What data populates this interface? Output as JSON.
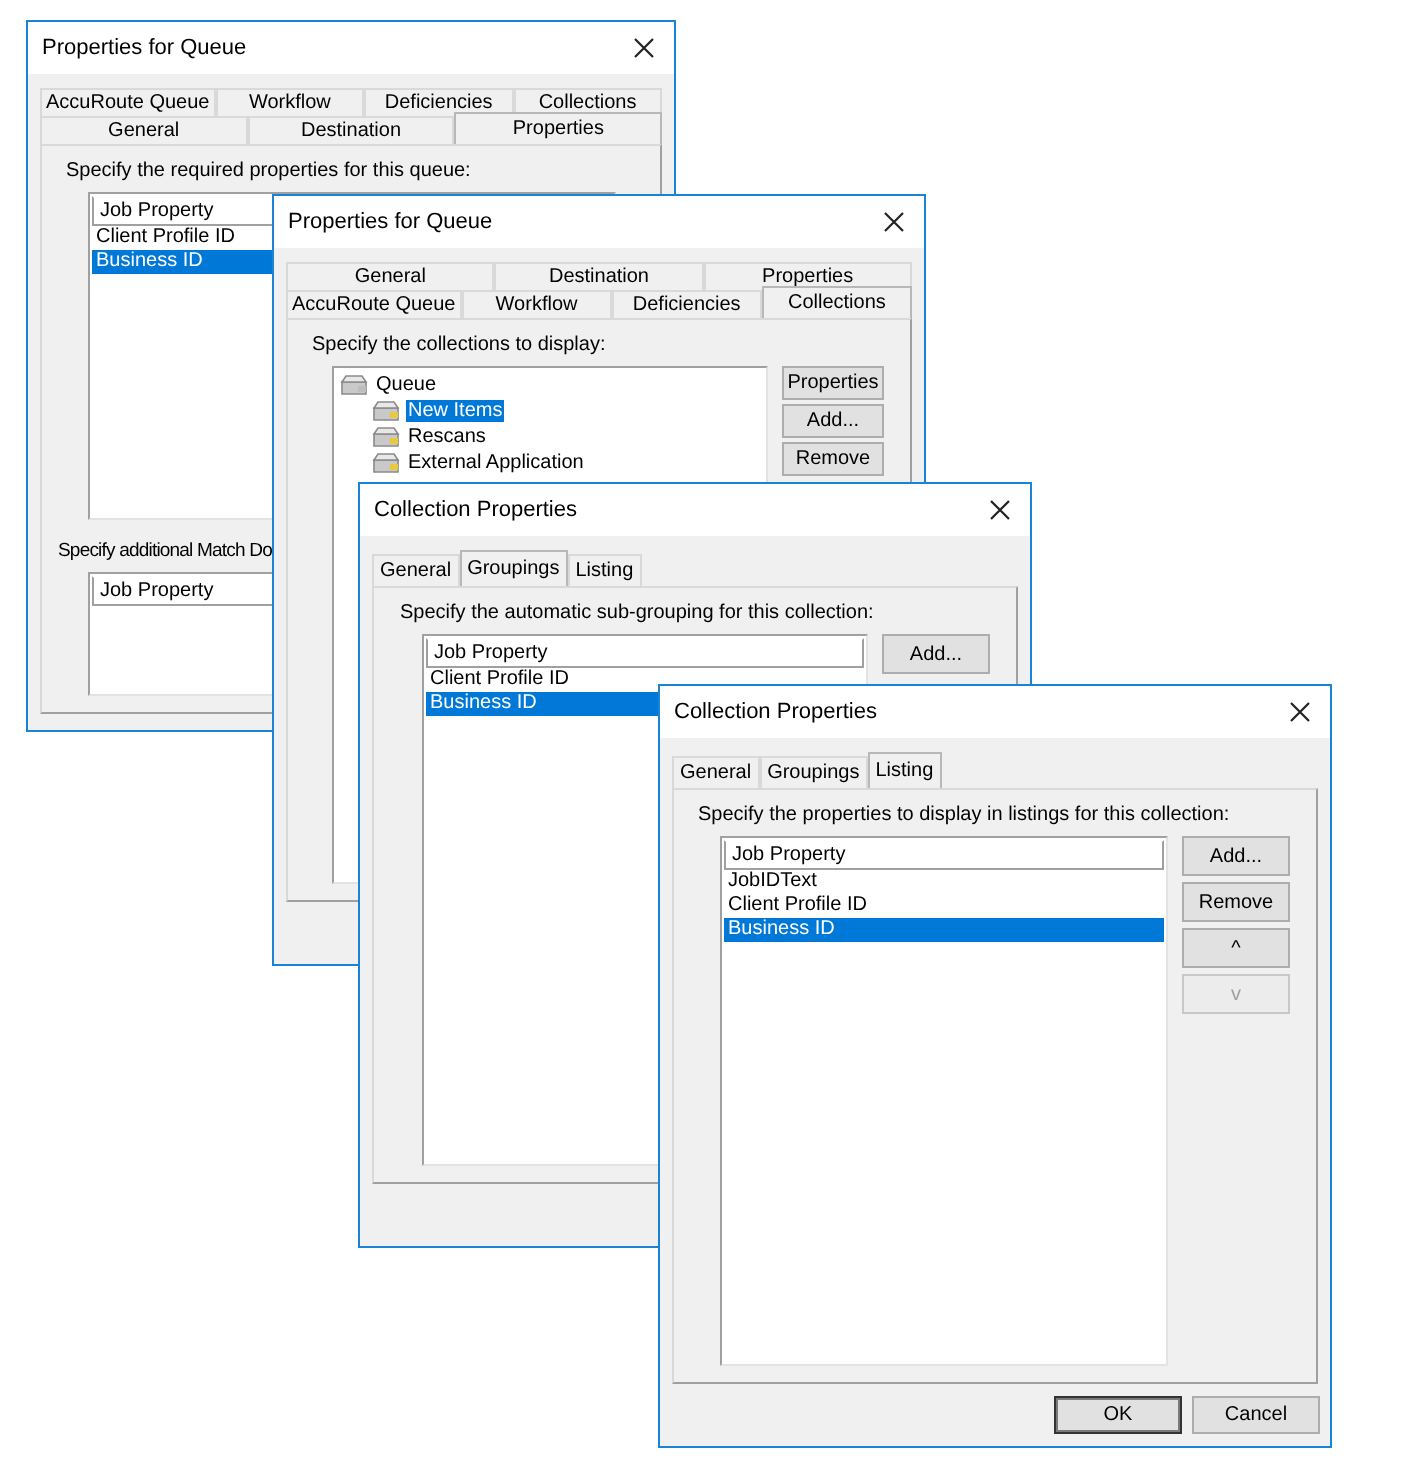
{
  "windows": [
    {
      "title": "Properties for Queue",
      "tab_rows": [
        {
          "tabs": [
            {
              "label": "AccuRoute Queue",
              "selected": false
            },
            {
              "label": "Workflow",
              "selected": false
            },
            {
              "label": "Deficiencies",
              "selected": false
            },
            {
              "label": "Collections",
              "selected": false
            }
          ]
        },
        {
          "tabs": [
            {
              "label": "General",
              "selected": false
            },
            {
              "label": "Destination",
              "selected": false
            },
            {
              "label": "Properties",
              "selected": true
            }
          ]
        }
      ],
      "sections": [
        {
          "prompt": "Specify the required properties for this queue:",
          "list": {
            "kind": "table",
            "header": "Job Property",
            "rows": [
              {
                "text": "Client Profile ID",
                "selected": false
              },
              {
                "text": "Business ID",
                "selected": true
              }
            ]
          }
        },
        {
          "prompt": "Specify additional Match Do",
          "list": {
            "kind": "table",
            "header": "Job Property"
          }
        }
      ]
    },
    {
      "title": "Properties for Queue",
      "tab_rows": [
        {
          "tabs": [
            {
              "label": "General",
              "selected": false
            },
            {
              "label": "Destination",
              "selected": false
            },
            {
              "label": "Properties",
              "selected": false
            }
          ]
        },
        {
          "tabs": [
            {
              "label": "AccuRoute Queue",
              "selected": false
            },
            {
              "label": "Workflow",
              "selected": false
            },
            {
              "label": "Deficiencies",
              "selected": false
            },
            {
              "label": "Collections",
              "selected": true
            }
          ]
        }
      ],
      "sections": [
        {
          "prompt": "Specify the collections to display:",
          "list": {
            "kind": "tree",
            "items": [
              {
                "label": "Queue",
                "selected": false,
                "children": [
                  {
                    "label": "New Items",
                    "selected": true
                  },
                  {
                    "label": "Rescans",
                    "selected": false
                  },
                  {
                    "label": "External Application",
                    "selected": false
                  }
                ]
              }
            ]
          },
          "buttons": [
            {
              "label": "Properties",
              "disabled": false
            },
            {
              "label": "Add...",
              "disabled": false
            },
            {
              "label": "Remove",
              "disabled": false
            }
          ]
        }
      ]
    },
    {
      "title": "Collection Properties",
      "tab_rows": [
        {
          "tabs": [
            {
              "label": "General",
              "selected": false
            },
            {
              "label": "Groupings",
              "selected": true
            },
            {
              "label": "Listing",
              "selected": false
            }
          ]
        }
      ],
      "sections": [
        {
          "prompt": "Specify the automatic sub-grouping for this collection:",
          "list": {
            "kind": "table",
            "header": "Job Property",
            "rows": [
              {
                "text": "Client Profile ID",
                "selected": false
              },
              {
                "text": "Business ID",
                "selected": true
              }
            ]
          },
          "buttons": [
            {
              "label": "Add...",
              "disabled": false
            }
          ]
        }
      ]
    },
    {
      "title": "Collection Properties",
      "tab_rows": [
        {
          "tabs": [
            {
              "label": "General",
              "selected": false
            },
            {
              "label": "Groupings",
              "selected": false
            },
            {
              "label": "Listing",
              "selected": true
            }
          ]
        }
      ],
      "sections": [
        {
          "prompt": "Specify the properties to display in listings for this collection:",
          "list": {
            "kind": "table",
            "header": "Job Property",
            "rows": [
              {
                "text": "JobIDText",
                "selected": false
              },
              {
                "text": "Client Profile ID",
                "selected": false
              },
              {
                "text": "Business ID",
                "selected": true
              }
            ]
          },
          "buttons": [
            {
              "label": "Add...",
              "disabled": false
            },
            {
              "label": "Remove",
              "disabled": false
            },
            {
              "label": "^",
              "disabled": false
            },
            {
              "label": "v",
              "disabled": true
            }
          ]
        }
      ],
      "footer_buttons": [
        {
          "label": "OK",
          "default": true
        },
        {
          "label": "Cancel",
          "default": false
        }
      ]
    }
  ]
}
